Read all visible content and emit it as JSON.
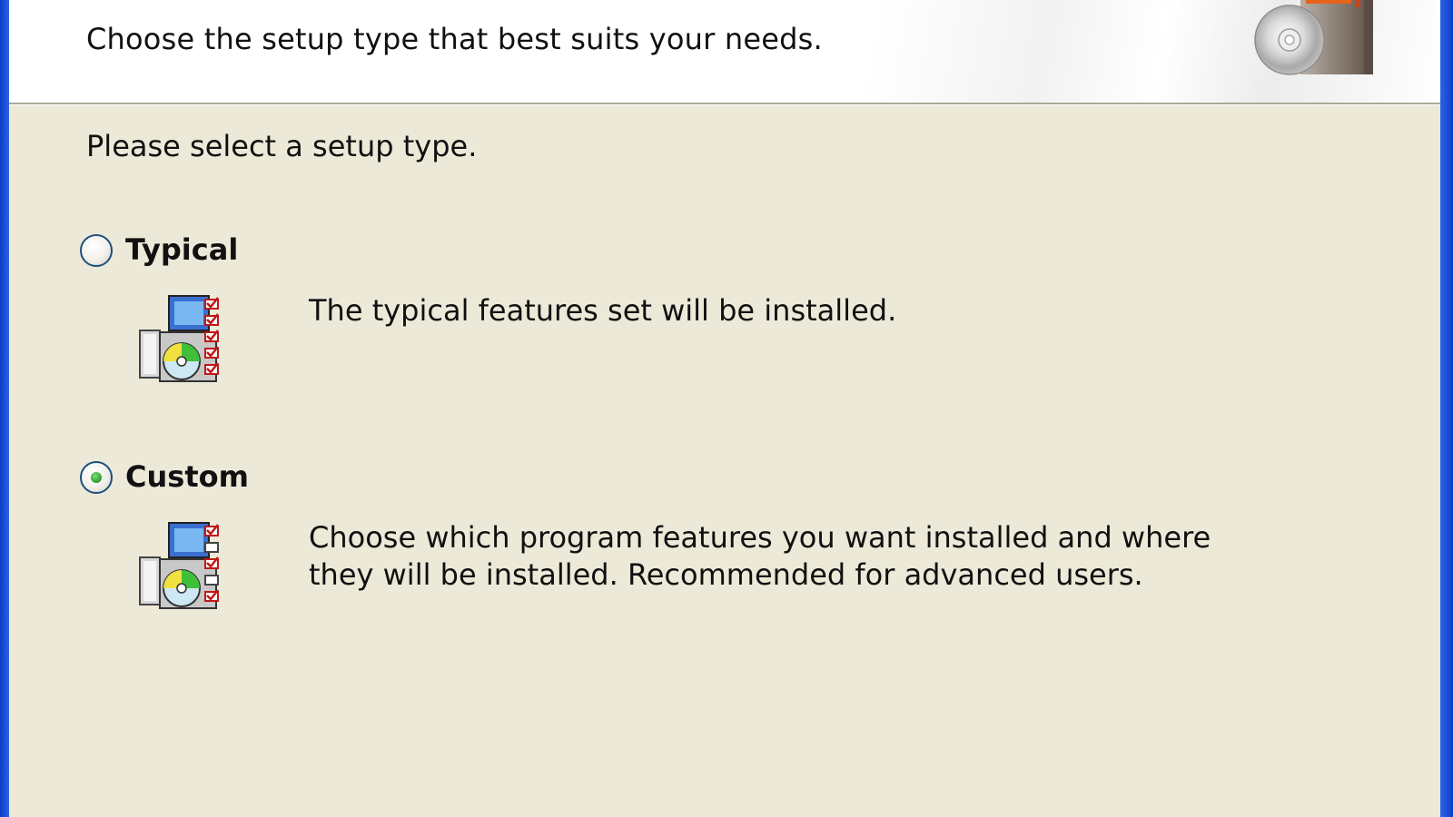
{
  "banner": {
    "subtitle": "Choose the setup type that best suits your needs."
  },
  "instruction": "Please select a setup type.",
  "options": [
    {
      "label": "Typical",
      "selected": false,
      "description_lines": [
        "The typical features set will be installed."
      ]
    },
    {
      "label": "Custom",
      "selected": true,
      "description_lines": [
        "Choose which program features you want installed and where",
        "they will be installed. Recommended for advanced users."
      ]
    }
  ],
  "icons": {
    "banner": "product-box-cd-icon",
    "typical": "setup-typical-icon",
    "custom": "setup-custom-icon"
  },
  "colors": {
    "dialog_background": "#ece9d8",
    "window_frame": "#0a45d8",
    "radio_selected_dot": "#2f9b2a"
  }
}
